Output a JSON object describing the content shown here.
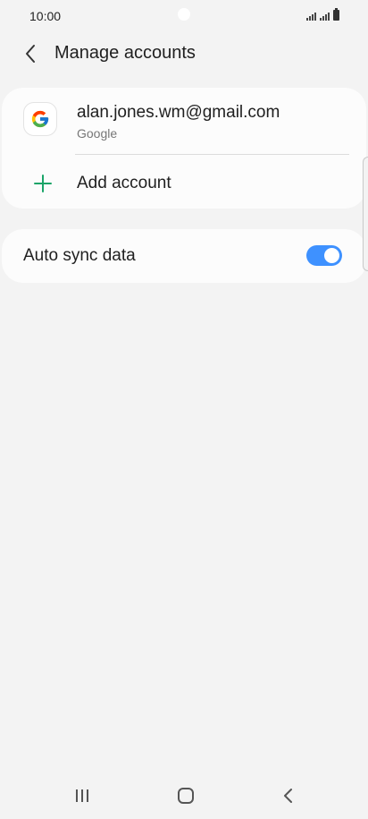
{
  "status_bar": {
    "time": "10:00"
  },
  "header": {
    "title": "Manage accounts",
    "back_icon": "chevron-left-icon"
  },
  "accounts": [
    {
      "email": "alan.jones.wm@gmail.com",
      "type": "Google",
      "icon": "google-icon"
    }
  ],
  "add_account": {
    "label": "Add account",
    "icon": "plus-icon",
    "icon_color": "#1aa468"
  },
  "sync": {
    "label": "Auto sync data",
    "enabled": true,
    "toggle_color": "#3e91ff"
  },
  "nav_bar": {
    "recents_icon": "recents-icon",
    "home_icon": "home-icon",
    "back_icon": "back-icon"
  }
}
